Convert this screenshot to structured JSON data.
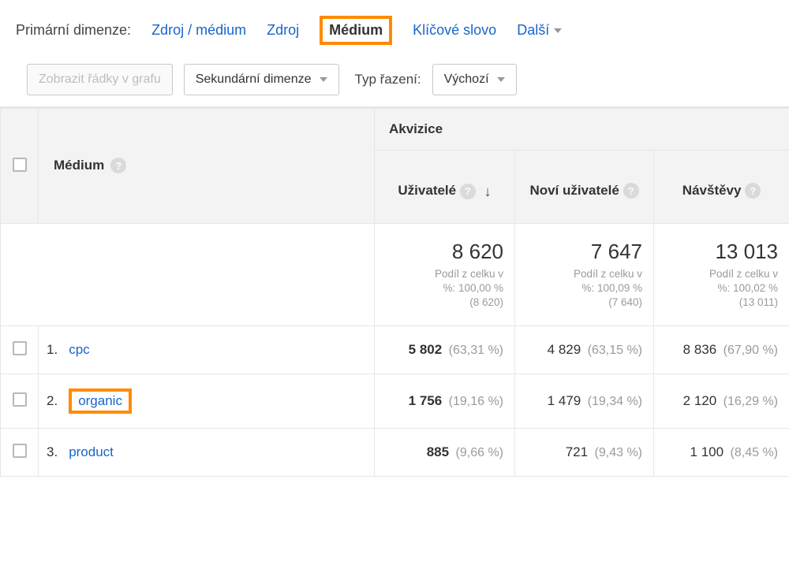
{
  "tabs": {
    "label": "Primární dimenze:",
    "items": [
      {
        "label": "Zdroj / médium",
        "active": false
      },
      {
        "label": "Zdroj",
        "active": false
      },
      {
        "label": "Médium",
        "active": true
      },
      {
        "label": "Klíčové slovo",
        "active": false
      }
    ],
    "more": "Další"
  },
  "toolbar": {
    "graph_rows": "Zobrazit řádky v grafu",
    "secondary_dim": "Sekundární dimenze",
    "sort_label": "Typ řazení:",
    "sort_value": "Výchozí"
  },
  "table": {
    "dim_header": "Médium",
    "section_header": "Akvizice",
    "metrics": [
      {
        "label": "Uživatelé",
        "sorted": true
      },
      {
        "label": "Noví uživatelé",
        "sorted": false
      },
      {
        "label": "Návštěvy",
        "sorted": false
      }
    ],
    "totals": [
      {
        "big": "8 620",
        "sub1": "Podíl z celku v",
        "sub2": "%: 100,00 %",
        "sub3": "(8 620)"
      },
      {
        "big": "7 647",
        "sub1": "Podíl z celku v",
        "sub2": "%: 100,09 %",
        "sub3": "(7 640)"
      },
      {
        "big": "13 013",
        "sub1": "Podíl z celku v",
        "sub2": "%: 100,02 %",
        "sub3": "(13 011)"
      }
    ],
    "rows": [
      {
        "idx": "1.",
        "name": "cpc",
        "highlight": false,
        "cells": [
          {
            "v": "5 802",
            "p": "(63,31 %)"
          },
          {
            "v": "4 829",
            "p": "(63,15 %)"
          },
          {
            "v": "8 836",
            "p": "(67,90 %)"
          }
        ]
      },
      {
        "idx": "2.",
        "name": "organic",
        "highlight": true,
        "cells": [
          {
            "v": "1 756",
            "p": "(19,16 %)"
          },
          {
            "v": "1 479",
            "p": "(19,34 %)"
          },
          {
            "v": "2 120",
            "p": "(16,29 %)"
          }
        ]
      },
      {
        "idx": "3.",
        "name": "product",
        "highlight": false,
        "cells": [
          {
            "v": "885",
            "p": "(9,66 %)"
          },
          {
            "v": "721",
            "p": "(9,43 %)"
          },
          {
            "v": "1 100",
            "p": "(8,45 %)"
          }
        ]
      }
    ]
  }
}
